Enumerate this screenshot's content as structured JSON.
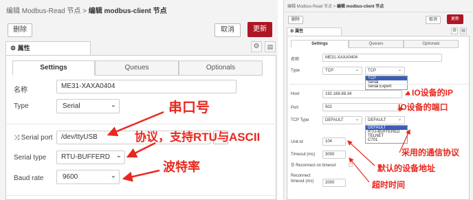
{
  "left": {
    "header": {
      "prefix": "编辑 Modbus-Read 节点 > ",
      "title": "编辑 modbus-client 节点"
    },
    "buttons": {
      "delete": "删除",
      "cancel": "取消",
      "update": "更新"
    },
    "props_label": "属性",
    "tabs": [
      "Settings",
      "Queues",
      "Optionals"
    ],
    "fields": {
      "name_label": "名称",
      "name_value": "ME31-XAXA0404",
      "type_label": "Type",
      "type_value": "Serial",
      "serial_port_label": "Serial port",
      "serial_port_value": "/dev/ttyUSB",
      "serial_type_label": "Serial type",
      "serial_type_value": "RTU-BUFFERD",
      "baud_label": "Baud rate",
      "baud_value": "9600"
    },
    "annotations": {
      "serial_port": "串口号",
      "protocol": "协议，支持RTU与ASCII",
      "baud": "波特率"
    }
  },
  "right": {
    "header": {
      "prefix": "编辑 Modbus-Read 节点 > ",
      "title": "编辑 modbus-client 节点"
    },
    "buttons": {
      "delete": "删除",
      "cancel": "取消",
      "update": "更新"
    },
    "props_label": "属性",
    "tabs": [
      "Settings",
      "Queues",
      "Optionals"
    ],
    "fields": {
      "name_label": "名称",
      "name_value": "ME31-XAXA0404",
      "type_label": "Type",
      "type_value": "TCP",
      "type_dropdown_value": "TCP",
      "type_options": [
        "TCP",
        "Serial",
        "Serial Expert"
      ],
      "host_label": "Host",
      "host_value": "192.168.88.34",
      "port_label": "Port",
      "port_value": "502",
      "tcp_type_label": "TCP Type",
      "tcp_type_value": "DEFAULT",
      "tcp_dropdown_value": "DEFAULT",
      "tcp_options": [
        "DEFAULT",
        "RTU-BUFFERED",
        "TELNET",
        "C701"
      ],
      "unit_id_label": "Unit-Id",
      "unit_id_value": "104",
      "timeout_label": "Timeout (ms)",
      "timeout_value": "3000",
      "reconnect_label": "Reconnect on timeout",
      "reconnect_timeout_label": "Reconnect timeout (ms)",
      "reconnect_timeout_value": "2000"
    },
    "annotations": {
      "ip": "IO设备的IP",
      "port": "IO设备的端口",
      "protocol": "采用的通信协议",
      "unit_id": "默认的设备地址",
      "timeout": "超时时间"
    }
  },
  "colors": {
    "accent_red": "#ad1625",
    "annotation": "#e8281e",
    "selected": "#3b5fb8"
  }
}
